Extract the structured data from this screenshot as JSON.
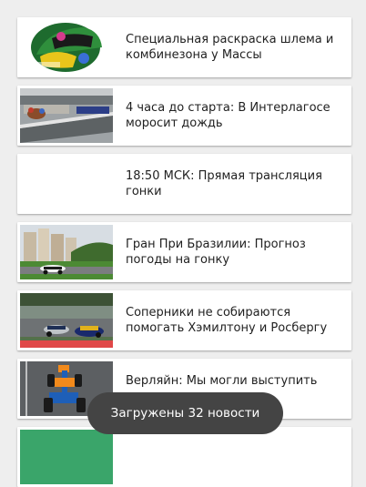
{
  "news": {
    "items": [
      {
        "title": "Специальная раскраска шлема и комбинезона у Массы",
        "image": "helmet-photo"
      },
      {
        "title": "4 часа до старта: В Интерлагосе моросит дождь",
        "image": "rainy-track-photo"
      },
      {
        "title": "18:50 МСК: Прямая трансляция гонки",
        "image": ""
      },
      {
        "title": "Гран При Бразилии: Прогноз погоды на гонку",
        "image": "city-track-photo"
      },
      {
        "title": "Соперники не собираются помогать Хэмилтону и Росбергу",
        "image": "race-cars-photo"
      },
      {
        "title": "Верляйн: Мы могли выступить сильнее",
        "image": "overhead-car-photo"
      },
      {
        "title": "",
        "image": "green-photo"
      }
    ]
  },
  "toast": {
    "message": "Загружены 32 новости"
  },
  "colors": {
    "background": "#eeeeee",
    "card": "#ffffff",
    "toast": "#444444"
  }
}
